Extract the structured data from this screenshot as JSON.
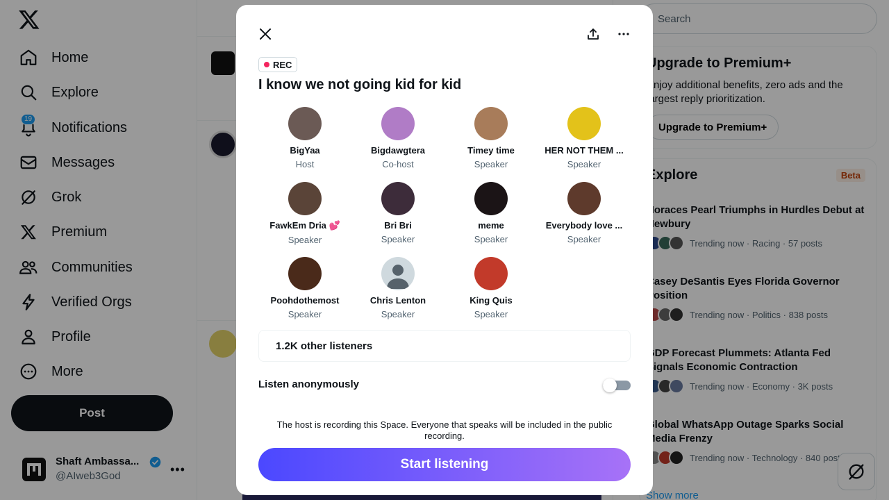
{
  "nav": {
    "items": [
      {
        "label": "Home",
        "icon": "home-icon"
      },
      {
        "label": "Explore",
        "icon": "search-icon"
      },
      {
        "label": "Notifications",
        "icon": "bell-icon",
        "badge": "19"
      },
      {
        "label": "Messages",
        "icon": "envelope-icon"
      },
      {
        "label": "Grok",
        "icon": "grok-icon"
      },
      {
        "label": "Premium",
        "icon": "x-logo-icon"
      },
      {
        "label": "Communities",
        "icon": "people-icon"
      },
      {
        "label": "Verified Orgs",
        "icon": "lightning-icon"
      },
      {
        "label": "Profile",
        "icon": "person-icon"
      },
      {
        "label": "More",
        "icon": "more-circle-icon"
      }
    ],
    "post_label": "Post"
  },
  "account": {
    "name": "Shaft Ambassa...",
    "handle": "@AIweb3God"
  },
  "search": {
    "placeholder": "Search"
  },
  "premium": {
    "title": "Upgrade to Premium+",
    "text": "Enjoy additional benefits, zero ads and the largest reply prioritization.",
    "button": "Upgrade to Premium+"
  },
  "explore": {
    "title": "Explore",
    "badge": "Beta",
    "trends": [
      {
        "title": "Horaces Pearl Triumphs in Hurdles Debut at Newbury",
        "meta": "Trending now · Racing · 57 posts"
      },
      {
        "title": "Casey DeSantis Eyes Florida Governor Position",
        "meta": "Trending now · Politics · 838 posts"
      },
      {
        "title": "GDP Forecast Plummets: Atlanta Fed Signals Economic Contraction",
        "meta": "Trending now · Economy · 3K posts"
      },
      {
        "title": "Global WhatsApp Outage Sparks Social Media Frenzy",
        "meta": "Trending now · Technology · 840 posts"
      }
    ],
    "show_more": "Show more"
  },
  "space": {
    "rec_label": "REC",
    "title": "I know we not going kid for kid",
    "speakers": [
      {
        "name": "BigYaa",
        "role": "Host",
        "color": "#6b5a55"
      },
      {
        "name": "Bigdawgtera",
        "role": "Co-host",
        "color": "#b07cc6"
      },
      {
        "name": "Timey time",
        "role": "Speaker",
        "color": "#a87c5a"
      },
      {
        "name": "HER NOT THEM ...",
        "role": "Speaker",
        "color": "#e3c21a"
      },
      {
        "name": "FawkEm Dria 💕",
        "role": "Speaker",
        "color": "#5a4438"
      },
      {
        "name": "Bri Bri",
        "role": "Speaker",
        "color": "#3d2c3a"
      },
      {
        "name": "meme",
        "role": "Speaker",
        "color": "#1b1416"
      },
      {
        "name": "Everybody love ...",
        "role": "Speaker",
        "color": "#5e3a2c"
      },
      {
        "name": "Poohdothemost",
        "role": "Speaker",
        "color": "#4a2a1a"
      },
      {
        "name": "Chris Lenton",
        "role": "Speaker",
        "color": "#cfd9de"
      },
      {
        "name": "King Quis",
        "role": "Speaker",
        "color": "#c23a2a"
      }
    ],
    "listeners": "1.2K other listeners",
    "anon_label": "Listen anonymously",
    "anon_on": false,
    "notice": "The host is recording this Space. Everyone that speaks will be included in the public recording.",
    "start_button": "Start listening"
  }
}
